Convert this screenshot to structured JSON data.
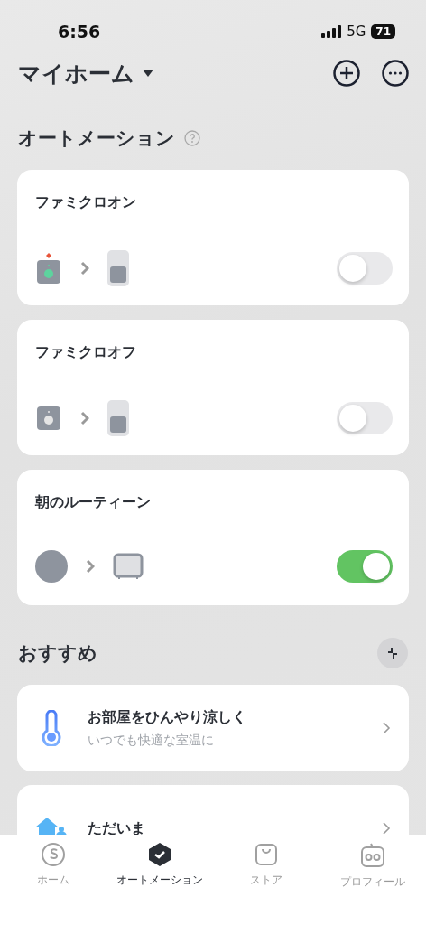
{
  "status_bar": {
    "time": "6:56",
    "network": "5G",
    "battery": "71"
  },
  "header": {
    "title": "マイホーム"
  },
  "automation_section": {
    "title": "オートメーション"
  },
  "automations": [
    {
      "name": "ファミクロオン",
      "on": false
    },
    {
      "name": "ファミクロオフ",
      "on": false
    },
    {
      "name": "朝のルーティーン",
      "on": true
    }
  ],
  "recommend_section": {
    "title": "おすすめ"
  },
  "recommendations": [
    {
      "title": "お部屋をひんやり涼しく",
      "subtitle": "いつでも快適な室温に"
    },
    {
      "title": "ただいま"
    }
  ],
  "tabs": [
    {
      "label": "ホーム",
      "selected": false
    },
    {
      "label": "オートメーション",
      "selected": true
    },
    {
      "label": "ストア",
      "selected": false
    },
    {
      "label": "プロフィール",
      "selected": false
    }
  ]
}
